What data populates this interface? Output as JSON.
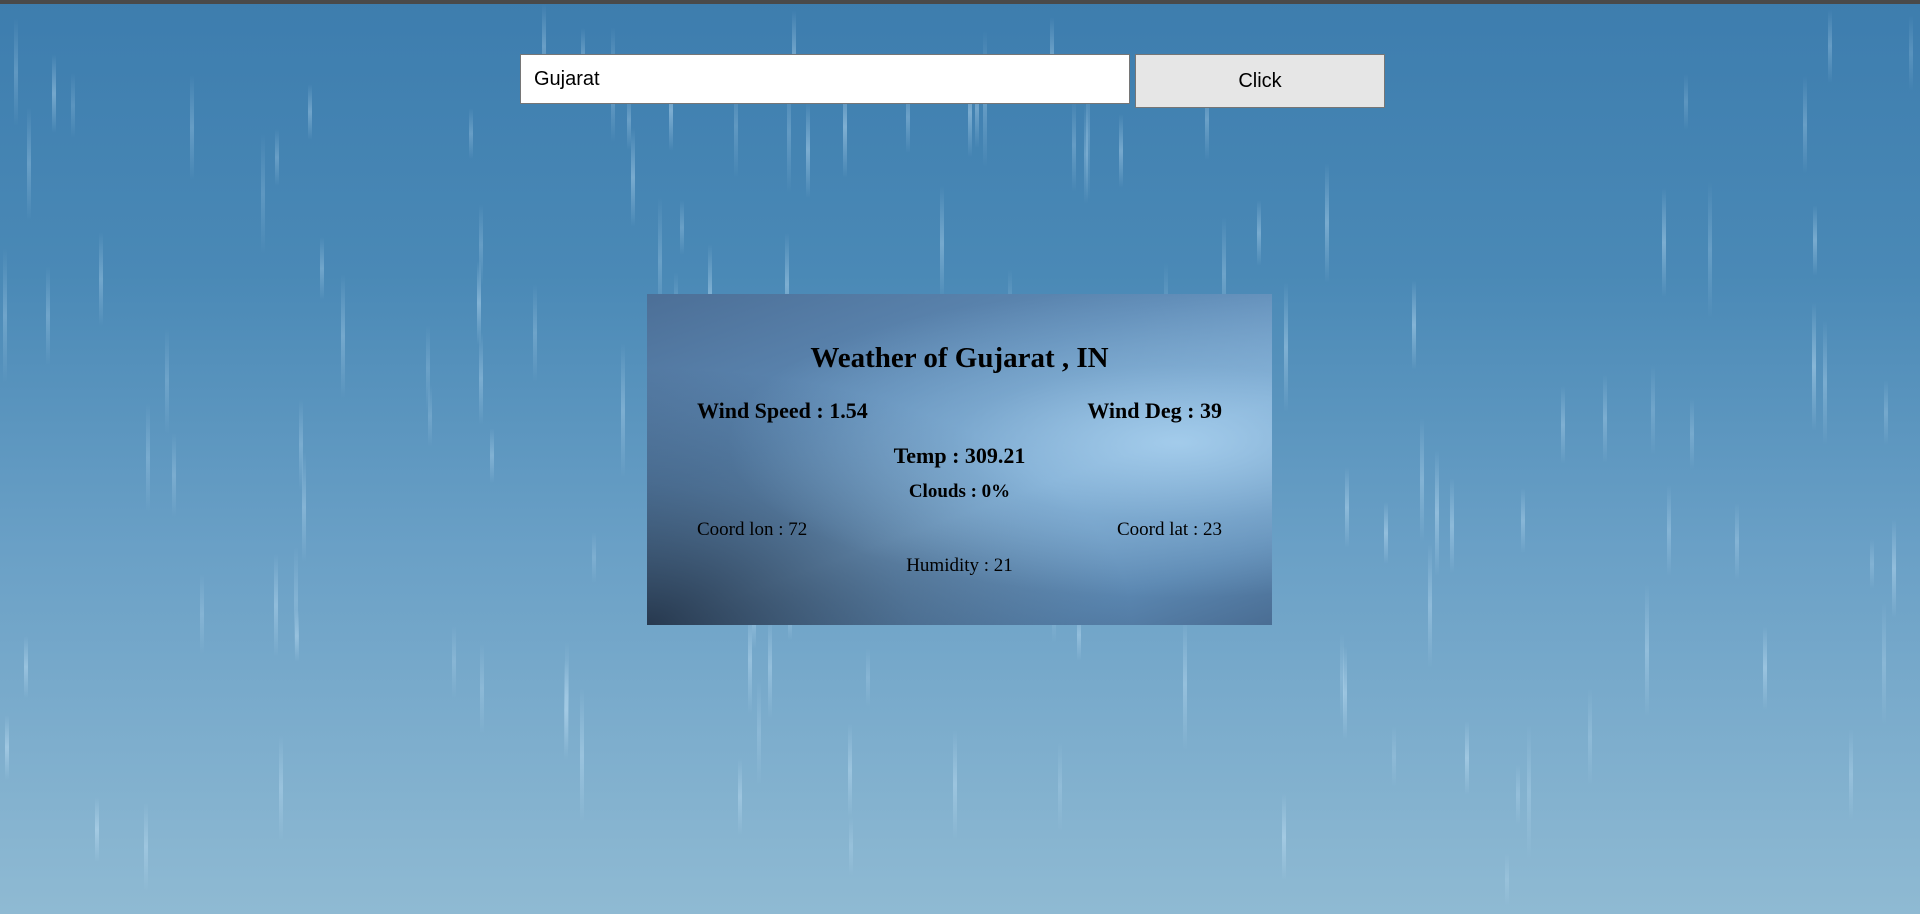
{
  "search": {
    "value": "Gujarat",
    "button_label": "Click"
  },
  "weather": {
    "title": "Weather of Gujarat , IN",
    "wind_speed": "Wind Speed : 1.54",
    "wind_deg": "Wind Deg : 39",
    "temp": "Temp : 309.21",
    "clouds": "Clouds : 0%",
    "coord_lon": "Coord lon : 72",
    "coord_lat": "Coord lat : 23",
    "humidity": "Humidity : 21"
  }
}
